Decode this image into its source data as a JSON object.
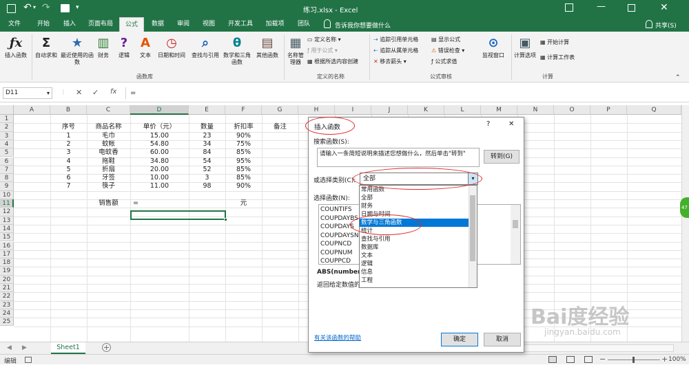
{
  "titlebar": {
    "center_title": "练习.xlsx - Excel",
    "search_hint": "告诉我你想要做什么",
    "share_label": "共享(S)"
  },
  "tabs": [
    "文件",
    "开始",
    "插入",
    "页面布局",
    "公式",
    "数据",
    "审阅",
    "视图",
    "开发工具",
    "加载项",
    "团队"
  ],
  "ribbon": {
    "insert_function": "插入函数",
    "autosum": "自动求和",
    "recent": "最近使用的函数",
    "financial": "财务",
    "logical": "逻辑",
    "text": "文本",
    "datetime": "日期和时间",
    "lookup": "查找与引用",
    "math": "数学和三角函数",
    "more": "其他函数",
    "group_library": "函数库",
    "name_manager": "名称管理器",
    "define_name": "定义名称",
    "use_in_formula": "用于公式",
    "create_from_selection": "根据所选内容创建",
    "group_names": "定义的名称",
    "trace_precedents": "追踪引用单元格",
    "trace_dependents": "追踪从属单元格",
    "remove_arrows": "移去箭头",
    "show_formulas": "显示公式",
    "error_checking": "错误检查",
    "evaluate_formula": "公式求值",
    "group_auditing": "公式审核",
    "watch_window": "监视窗口",
    "calc_options": "计算选项",
    "calc_now": "开始计算",
    "calc_sheet": "计算工作表",
    "group_calc": "计算"
  },
  "formula_bar": {
    "name_box": "D11",
    "fx": "fx",
    "formula": "="
  },
  "columns": [
    "A",
    "B",
    "C",
    "D",
    "E",
    "F",
    "G",
    "H",
    "I",
    "J",
    "K",
    "L",
    "M",
    "N",
    "O",
    "P",
    "Q"
  ],
  "rows": [
    "1",
    "2",
    "3",
    "4",
    "5",
    "6",
    "7",
    "8",
    "9",
    "10",
    "11",
    "12",
    "13",
    "14",
    "15",
    "16",
    "17",
    "18",
    "19",
    "20",
    "21",
    "22",
    "23",
    "24",
    "25"
  ],
  "table": {
    "headers": [
      "序号",
      "商品名称",
      "单价（元）",
      "数量",
      "折扣率",
      "备注"
    ],
    "rows": [
      [
        "1",
        "毛巾",
        "15.00",
        "23",
        "90%"
      ],
      [
        "2",
        "蚊帐",
        "54.80",
        "34",
        "75%"
      ],
      [
        "3",
        "电蚊香",
        "60.00",
        "84",
        "85%"
      ],
      [
        "4",
        "拖鞋",
        "34.80",
        "54",
        "95%"
      ],
      [
        "5",
        "折扇",
        "20.00",
        "52",
        "85%"
      ],
      [
        "6",
        "牙签",
        "10.00",
        "3",
        "85%"
      ],
      [
        "7",
        "筷子",
        "11.00",
        "98",
        "90%"
      ]
    ],
    "sales_label": "销售额",
    "sales_value": "=",
    "unit": "元"
  },
  "sheet": {
    "tab": "Sheet1",
    "status": "编辑",
    "zoom": "100%"
  },
  "dialog": {
    "title": "插入函数",
    "help": "?",
    "close": "✕",
    "search_label": "搜索函数(S):",
    "search_text": "请输入一条简短说明来描述您想做什么，然后单击\"转到\"",
    "go_button": "转到(G)",
    "category_label": "或选择类别(C):",
    "category_value": "全部",
    "category_options": [
      "常用函数",
      "全部",
      "财务",
      "日期与时间",
      "数学与三角函数",
      "统计",
      "查找与引用",
      "数据库",
      "文本",
      "逻辑",
      "信息",
      "工程"
    ],
    "category_selected": "数学与三角函数",
    "select_label": "选择函数(N):",
    "functions": [
      "COUNTIFS",
      "COUPDAYBS",
      "COUPDAYS",
      "COUPDAYSNC",
      "COUPNCD",
      "COUPNUM",
      "COUPPCD"
    ],
    "syntax": "ABS(number)",
    "description": "返回给定数值的",
    "help_link": "有关该函数的帮助",
    "ok": "确定",
    "cancel": "取消"
  },
  "side_badge": "47",
  "watermark": {
    "brand": "Bai度经验",
    "url": "jingyan.baidu.com"
  },
  "colors": {
    "excel_green": "#217346",
    "selection_blue": "#0078d7",
    "annotation_red": "#e02828"
  }
}
